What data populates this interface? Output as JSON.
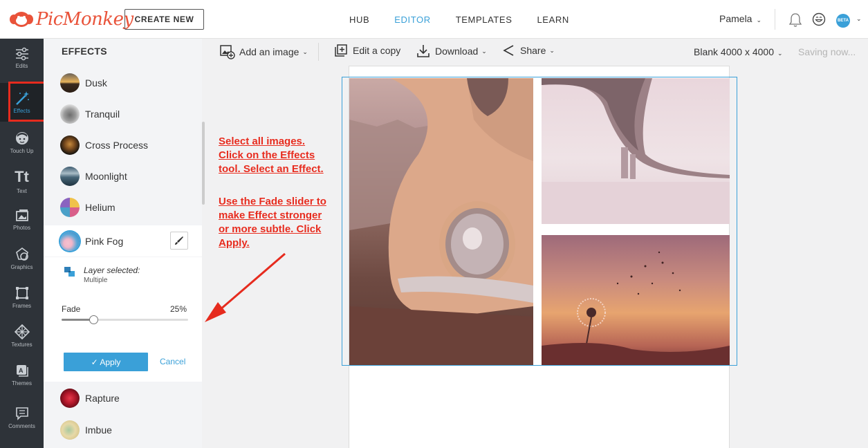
{
  "topnav": {
    "logo": "PicMonkey",
    "create_new": "CREATE NEW",
    "links": [
      {
        "label": "HUB"
      },
      {
        "label": "EDITOR"
      },
      {
        "label": "TEMPLATES"
      },
      {
        "label": "LEARN"
      }
    ],
    "user_name": "Pamela",
    "beta_badge": "BETA",
    "accent_color": "#3aa0d8"
  },
  "rail": [
    {
      "label": "Edits",
      "icon": "sliders-icon"
    },
    {
      "label": "Effects",
      "icon": "magic-wand-icon"
    },
    {
      "label": "Touch Up",
      "icon": "face-icon"
    },
    {
      "label": "Text",
      "icon": "text-icon"
    },
    {
      "label": "Photos",
      "icon": "photos-icon"
    },
    {
      "label": "Graphics",
      "icon": "graphics-icon"
    },
    {
      "label": "Frames",
      "icon": "frames-icon"
    },
    {
      "label": "Textures",
      "icon": "textures-icon"
    },
    {
      "label": "Themes",
      "icon": "themes-icon"
    },
    {
      "label": "Comments",
      "icon": "comments-icon"
    }
  ],
  "panel": {
    "title": "EFFECTS",
    "effects": [
      {
        "name": "Dusk"
      },
      {
        "name": "Tranquil"
      },
      {
        "name": "Cross Process"
      },
      {
        "name": "Moonlight"
      },
      {
        "name": "Helium"
      },
      {
        "name": "Pink Fog"
      },
      {
        "name": "Rapture"
      },
      {
        "name": "Imbue"
      }
    ],
    "edit": {
      "layer_title": "Layer selected:",
      "layer_value": "Multiple",
      "fade_label": "Fade",
      "fade_value": "25%",
      "fade_fraction": 0.25,
      "apply": "✓ Apply",
      "cancel": "Cancel"
    }
  },
  "toolbar": {
    "add_image": "Add an image",
    "edit_copy": "Edit a copy",
    "download": "Download",
    "share": "Share",
    "doc_size": "Blank 4000 x 4000",
    "saving": "Saving now..."
  },
  "annotation": {
    "line1": "Select all images.",
    "line2": "Click on the Effects",
    "line3": "tool. Select an Effect.",
    "line4": "Use the Fade slider to",
    "line5": "make Effect stronger",
    "line6": "or more subtle. Click",
    "line7": "Apply.",
    "color": "#e62b1e"
  }
}
